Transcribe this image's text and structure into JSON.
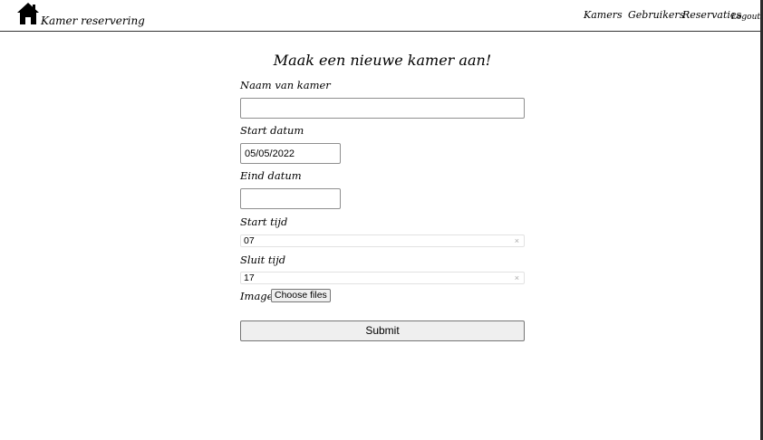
{
  "header": {
    "brand": "Kamer reservering",
    "logo_icon": "house-icon",
    "nav": {
      "kamers": "Kamers",
      "gebruikers": "Gebruikers",
      "reservaties": "Reservaties",
      "logout": "Logout"
    }
  },
  "form": {
    "title": "Maak een nieuwe kamer aan!",
    "name_label": "Naam van kamer",
    "name_value": "",
    "start_date_label": "Start datum",
    "start_date_value": "05/05/2022",
    "end_date_label": "Eind datum",
    "end_date_value": "",
    "start_time_label": "Start tijd",
    "start_time_value": "07",
    "close_time_label": "Sluit tijd",
    "close_time_value": "17",
    "clear_symbol": "×",
    "images_label": "Images",
    "choose_files_label": "Choose files",
    "submit_label": "Submit"
  }
}
